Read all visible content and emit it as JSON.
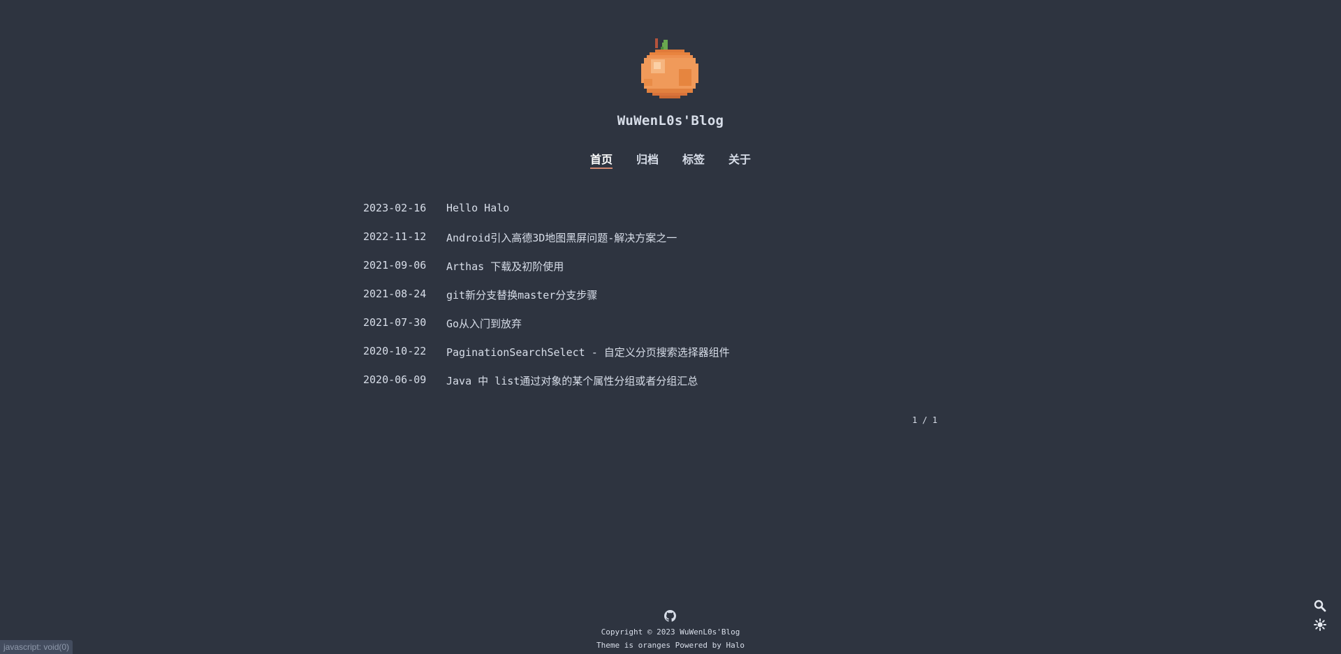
{
  "site": {
    "title": "WuWenL0s'Blog"
  },
  "nav": {
    "items": [
      "首页",
      "归档",
      "标签",
      "关于"
    ],
    "active": 0
  },
  "posts": [
    {
      "date": "2023-02-16",
      "title": "Hello Halo"
    },
    {
      "date": "2022-11-12",
      "title": "Android引入高德3D地图黑屏问题-解决方案之一"
    },
    {
      "date": "2021-09-06",
      "title": "Arthas 下载及初阶使用"
    },
    {
      "date": "2021-08-24",
      "title": "git新分支替换master分支步骤"
    },
    {
      "date": "2021-07-30",
      "title": "Go从入门到放弃"
    },
    {
      "date": "2020-10-22",
      "title": "PaginationSearchSelect - 自定义分页搜索选择器组件"
    },
    {
      "date": "2020-06-09",
      "title": "Java 中 list通过对象的某个属性分组或者分组汇总"
    }
  ],
  "pagination": {
    "text": "1 / 1"
  },
  "footer": {
    "copyright": "Copyright © 2023 WuWenL0s'Blog",
    "powered": "Theme is oranges Powered by Halo"
  },
  "icons": {
    "logo": "orange-logo-icon",
    "github": "github-icon",
    "search": "search-icon",
    "theme": "sun-theme-toggle-icon"
  },
  "colors": {
    "background": "#2e3440",
    "text": "#d8dee9",
    "accent": "#d08770"
  },
  "status_bar": {
    "text": "javascript: void(0)"
  }
}
